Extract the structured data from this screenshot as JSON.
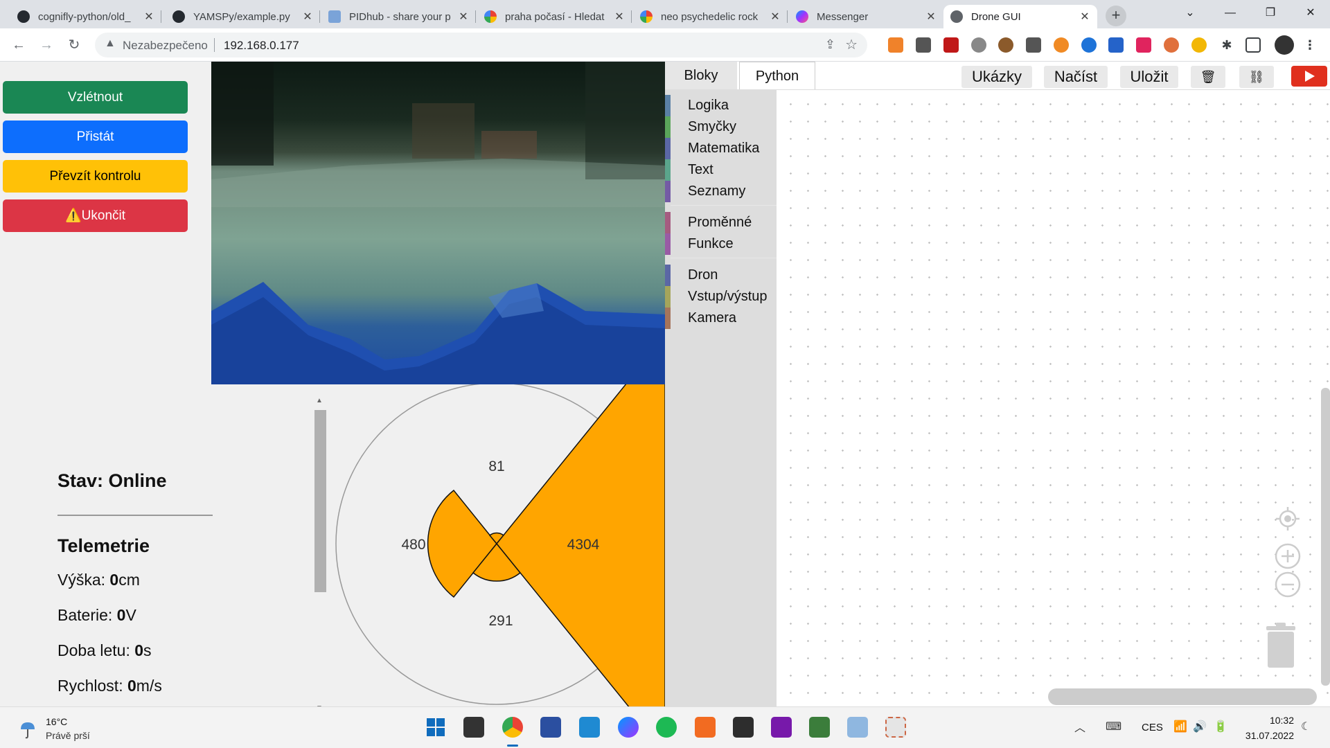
{
  "browser": {
    "tabs": [
      {
        "label": "cognifly-python/old_",
        "icon": "github-icon"
      },
      {
        "label": "YAMSPy/example.py",
        "icon": "github-icon"
      },
      {
        "label": "PIDhub - share your p",
        "icon": "pidhub-icon"
      },
      {
        "label": "praha počasí - Hledat",
        "icon": "google-icon"
      },
      {
        "label": "neo psychedelic rock",
        "icon": "google-icon"
      },
      {
        "label": "Messenger",
        "icon": "messenger-icon"
      },
      {
        "label": "Drone GUI",
        "icon": "globe-icon",
        "active": true
      }
    ],
    "address": {
      "security_label": "Nezabezpečeno",
      "url": "192.168.0.177"
    }
  },
  "controls": {
    "takeoff": "Vzlétnout",
    "land": "Přistát",
    "take_control": "Převzít kontrolu",
    "quit": "Ukončit"
  },
  "status": {
    "title": "Stav: Online",
    "telemetry_title": "Telemetrie",
    "rows": [
      {
        "label": "Výška: ",
        "value": "0",
        "unit": "cm"
      },
      {
        "label": "Baterie: ",
        "value": "0",
        "unit": "V"
      },
      {
        "label": "Doba letu: ",
        "value": "0",
        "unit": "s"
      },
      {
        "label": "Rychlost: ",
        "value": "0",
        "unit": "m/s"
      }
    ]
  },
  "radar": {
    "front": "81",
    "left": "480",
    "right": "4304",
    "back": "291",
    "fill_color": "#ffa500"
  },
  "editor": {
    "tabs": [
      "Bloky",
      "Python"
    ],
    "buttons": {
      "examples": "Ukázky",
      "load": "Načíst",
      "save": "Uložit"
    },
    "toolbox": [
      {
        "label": "Logika",
        "color": "#5b80a5"
      },
      {
        "label": "Smyčky",
        "color": "#5ba55b"
      },
      {
        "label": "Matematika",
        "color": "#5b67a5"
      },
      {
        "label": "Text",
        "color": "#5ba58c"
      },
      {
        "label": "Seznamy",
        "color": "#745ba5"
      },
      {
        "label": "Proměnné",
        "color": "#a55b80"
      },
      {
        "label": "Funkce",
        "color": "#995ba5"
      },
      {
        "label": "Dron",
        "color": "#5b67a5"
      },
      {
        "label": "Vstup/výstup",
        "color": "#a5a55b"
      },
      {
        "label": "Kamera",
        "color": "#a5745b"
      }
    ]
  },
  "taskbar": {
    "weather_temp": "16°C",
    "weather_desc": "Právě prší",
    "language": "CES",
    "time": "10:32",
    "date": "31.07.2022"
  }
}
